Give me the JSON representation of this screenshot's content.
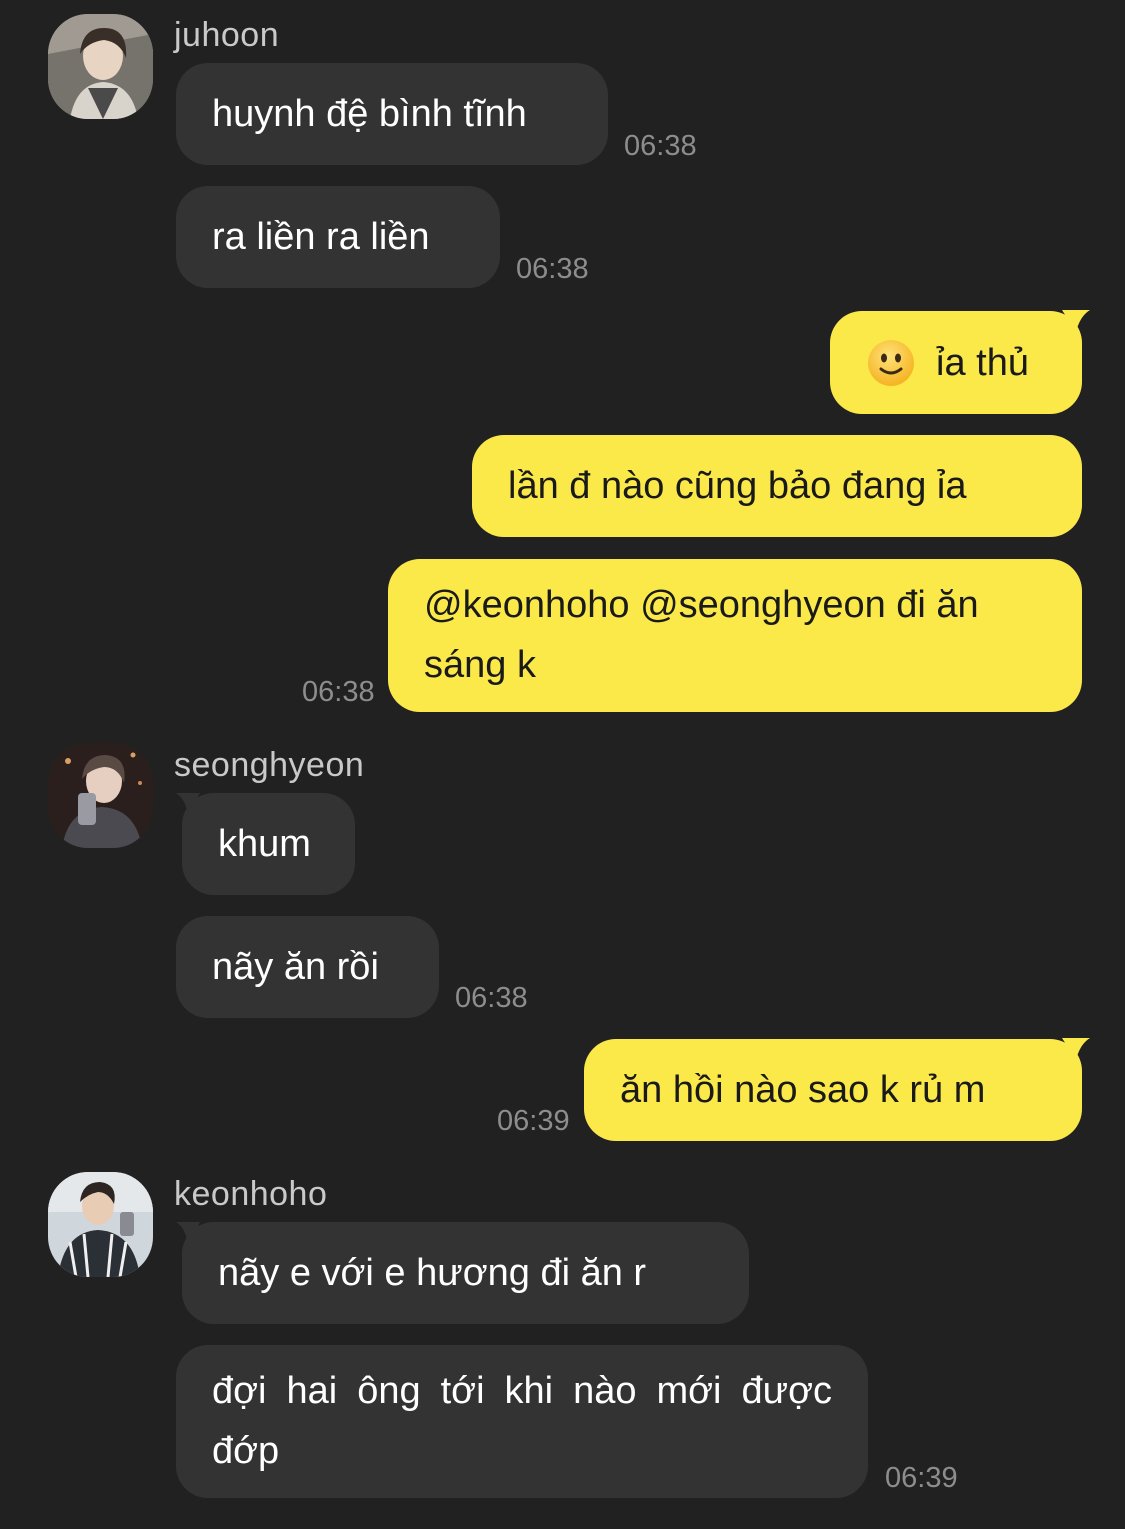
{
  "colors": {
    "background": "#212121",
    "incoming_bubble": "#333333",
    "outgoing_bubble": "#fbe94a",
    "timestamp": "#8d8d8d",
    "sender_name": "#c9c9c9"
  },
  "messages": [
    {
      "sender": "juhoon",
      "avatar": "juhoon-avatar",
      "text": "huynh đệ bình tĩnh",
      "time": ""
    },
    {
      "sender": "juhoon",
      "text": "",
      "time": "06:38"
    },
    {
      "sender": "juhoon",
      "text": "ra liền ra liền",
      "time": "06:38"
    },
    {
      "sender": "me",
      "emoji": "slightly-smiling-face-icon",
      "text": "ỉa thủ",
      "time": ""
    },
    {
      "sender": "me",
      "text": "lần đ nào cũng bảo đang ỉa",
      "time": ""
    },
    {
      "sender": "me",
      "text": "@keonhoho @seonghyeon đi ăn sáng k",
      "time": "06:38"
    },
    {
      "sender": "seonghyeon",
      "avatar": "seonghyeon-avatar",
      "text": "khum",
      "time": ""
    },
    {
      "sender": "seonghyeon",
      "text": "nãy ăn rồi",
      "time": "06:38"
    },
    {
      "sender": "me",
      "text": "ăn hồi nào sao k rủ m",
      "time": "06:39"
    },
    {
      "sender": "keonhoho",
      "avatar": "keonhoho-avatar",
      "text": "nãy e với e hương đi ăn r",
      "time": ""
    },
    {
      "sender": "keonhoho",
      "text": "đợi hai ông tới khi nào mới được đớp",
      "time": "06:39"
    }
  ]
}
